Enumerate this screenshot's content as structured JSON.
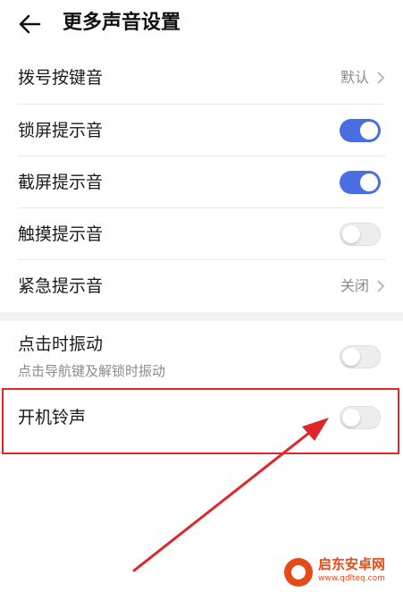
{
  "header": {
    "title": "更多声音设置",
    "back_icon": "back-arrow-icon"
  },
  "rows": {
    "dial_tone": {
      "label": "拨号按键音",
      "value": "默认"
    },
    "lock_screen": {
      "label": "锁屏提示音",
      "enabled": true
    },
    "screenshot": {
      "label": "截屏提示音",
      "enabled": true
    },
    "touch": {
      "label": "触摸提示音",
      "enabled": false
    },
    "emergency": {
      "label": "紧急提示音",
      "value": "关闭"
    },
    "tap_vibration": {
      "label": "点击时振动",
      "sub": "点击导航键及解锁时振动",
      "enabled": false
    },
    "boot_ringtone": {
      "label": "开机铃声",
      "enabled": false
    }
  },
  "watermark": {
    "name": "启东安卓网",
    "url": "www.qdlteq.com"
  },
  "colors": {
    "toggle_on": "#4a6ee0",
    "highlight": "#e0262b",
    "arrow": "#e0262b"
  }
}
